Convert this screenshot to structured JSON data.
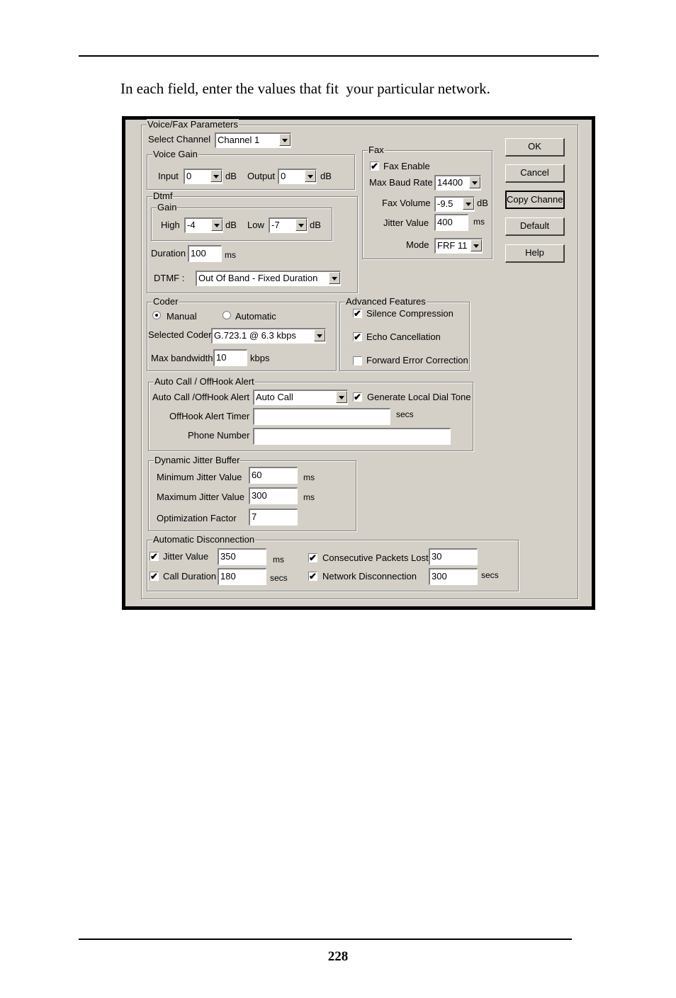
{
  "intro_text": "In each field, enter the values that fit  your particular network.",
  "page_number": "228",
  "dialog": {
    "voice_fax_group": "Voice/Fax Parameters",
    "select_channel": {
      "label": "Select Channel",
      "value": "Channel 1"
    },
    "voice_gain": {
      "title": "Voice Gain",
      "input_label": "Input",
      "input_value": "0",
      "input_unit": "dB",
      "output_label": "Output",
      "output_value": "0",
      "output_unit": "dB"
    },
    "dtmf": {
      "title": "Dtmf",
      "gain_title": "Gain",
      "high_label": "High",
      "high_value": "-4",
      "high_unit": "dB",
      "low_label": "Low",
      "low_value": "-7",
      "low_unit": "dB",
      "duration_label": "Duration",
      "duration_value": "100",
      "duration_unit": "ms",
      "mode_label": "DTMF :",
      "mode_value": "Out Of Band - Fixed Duration"
    },
    "fax": {
      "title": "Fax",
      "enable_label": "Fax Enable",
      "enable_checked": true,
      "baud_label": "Max Baud Rate",
      "baud_value": "14400",
      "volume_label": "Fax Volume",
      "volume_value": "-9.5",
      "volume_unit": "dB",
      "jitter_label": "Jitter Value",
      "jitter_value": "400",
      "jitter_unit": "ms",
      "mode_label": "Mode",
      "mode_value": "FRF 11"
    },
    "buttons": {
      "ok": "OK",
      "cancel": "Cancel",
      "copy": "Copy Channel",
      "default": "Default",
      "help": "Help"
    },
    "coder": {
      "title": "Coder",
      "manual_label": "Manual",
      "automatic_label": "Automatic",
      "selected_mode": "Manual",
      "selected_label": "Selected Coder",
      "selected_value": "G.723.1 @ 6.3 kbps",
      "bandwidth_label": "Max bandwidth",
      "bandwidth_value": "10",
      "bandwidth_unit": "kbps"
    },
    "advanced": {
      "title": "Advanced Features",
      "silence_label": "Silence Compression",
      "silence_checked": true,
      "echo_label": "Echo Cancellation",
      "echo_checked": true,
      "fec_label": "Forward Error Correction",
      "fec_checked": false
    },
    "autocall": {
      "title": "Auto Call / OffHook Alert",
      "mode_label": "Auto Call /OffHook Alert",
      "mode_value": "Auto Call",
      "dialtone_label": "Generate Local Dial Tone",
      "dialtone_checked": true,
      "timer_label": "OffHook Alert Timer",
      "timer_value": "",
      "timer_unit": "secs",
      "phone_label": "Phone Number",
      "phone_value": ""
    },
    "jitter_buffer": {
      "title": "Dynamic Jitter Buffer",
      "min_label": "Minimum Jitter Value",
      "min_value": "60",
      "min_unit": "ms",
      "max_label": "Maximum Jitter Value",
      "max_value": "300",
      "max_unit": "ms",
      "opt_label": "Optimization Factor",
      "opt_value": "7"
    },
    "auto_disconnect": {
      "title": "Automatic Disconnection",
      "jitter_label": "Jitter Value",
      "jitter_checked": true,
      "jitter_value": "350",
      "jitter_unit": "ms",
      "duration_label": "Call Duration",
      "duration_checked": true,
      "duration_value": "180",
      "duration_unit": "secs",
      "packets_label": "Consecutive Packets Lost",
      "packets_checked": true,
      "packets_value": "30",
      "network_label": "Network Disconnection",
      "network_checked": true,
      "network_value": "300",
      "network_unit": "secs"
    }
  },
  "check_mark": "✔"
}
